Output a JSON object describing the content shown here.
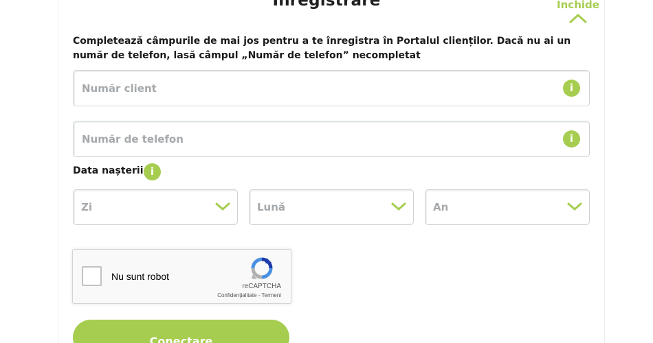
{
  "form": {
    "title": "Înregistrare",
    "close_label": "Închide",
    "intro": "Completează câmpurile de mai jos pentru a te înregistra în Portalul clienților. Dacă nu ai un număr de telefon, lasă câmpul „Număr de telefon” necompletat",
    "client_number": {
      "placeholder": "Număr client",
      "value": ""
    },
    "phone_number": {
      "placeholder": "Număr de telefon",
      "value": ""
    },
    "dob_label": "Data nașterii",
    "info_glyph": "i",
    "dob_selects": [
      {
        "label": "Zi"
      },
      {
        "label": "Lună"
      },
      {
        "label": "An"
      }
    ],
    "captcha": {
      "label": "Nu sunt robot",
      "brand": "reCAPTCHA",
      "privacy": "Confidențialitate",
      "separator": " - ",
      "terms": "Termeni"
    },
    "submit_label": "Conectare"
  },
  "colors": {
    "accent": "#a6cd4f",
    "border": "#cfd3d6",
    "placeholder": "#a5a9ac",
    "text": "#1a1a1a"
  },
  "icons": [
    "chevron-up-icon",
    "info-icon",
    "chevron-down-icon",
    "recaptcha-logo-icon"
  ]
}
